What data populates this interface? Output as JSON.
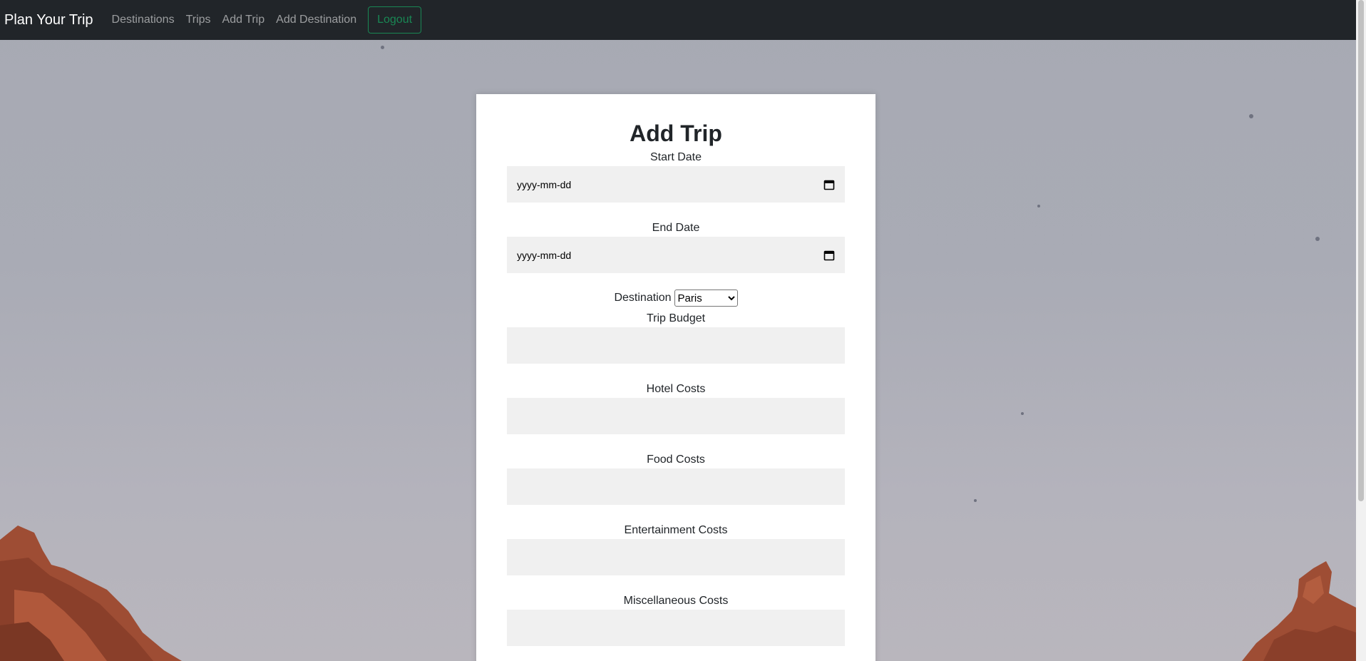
{
  "navbar": {
    "brand": "Plan Your Trip",
    "links": [
      "Destinations",
      "Trips",
      "Add Trip",
      "Add Destination"
    ],
    "logout_label": "Logout"
  },
  "form": {
    "title": "Add Trip",
    "start_date": {
      "label": "Start Date",
      "placeholder": "yyyy-mm-dd"
    },
    "end_date": {
      "label": "End Date",
      "placeholder": "yyyy-mm-dd"
    },
    "destination": {
      "label": "Destination",
      "selected": "Paris"
    },
    "trip_budget": {
      "label": "Trip Budget",
      "value": ""
    },
    "hotel_costs": {
      "label": "Hotel Costs",
      "value": ""
    },
    "food_costs": {
      "label": "Food Costs",
      "value": ""
    },
    "entertainment_costs": {
      "label": "Entertainment Costs",
      "value": ""
    },
    "misc_costs": {
      "label": "Miscellaneous Costs",
      "value": ""
    }
  },
  "icons": {
    "calendar": "calendar-icon",
    "select_arrow": "chevron-down-icon"
  },
  "colors": {
    "navbar_bg": "#212529",
    "logout_accent": "#198754",
    "input_bg": "#f0f0f0",
    "rock": "#9e4d34"
  }
}
